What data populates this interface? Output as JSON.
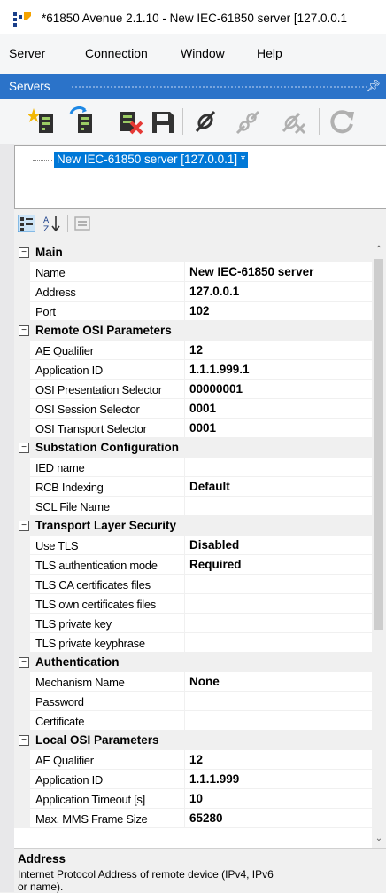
{
  "window": {
    "title": "*61850 Avenue 2.1.10 - New IEC-61850 server [127.0.0.1"
  },
  "menu": [
    "Server",
    "Connection",
    "Window",
    "Help"
  ],
  "dock": {
    "title": "Servers",
    "pin_icon": "pin-icon"
  },
  "toolbar": {
    "icons": [
      "new-server-icon",
      "connect-server-icon",
      "remove-server-icon",
      "save-icon",
      "connect-icon",
      "disconnect-icon",
      "abort-icon",
      "refresh-icon"
    ]
  },
  "tree": {
    "selected_node": "New IEC-61850 server [127.0.0.1] *"
  },
  "property_grid": {
    "toolbar_icons": [
      "categorized-icon",
      "alphabetical-icon",
      "property-pages-icon"
    ],
    "categories": [
      {
        "label": "Main",
        "rows": [
          {
            "name": "Name",
            "value": "New IEC-61850 server"
          },
          {
            "name": "Address",
            "value": "127.0.0.1"
          },
          {
            "name": "Port",
            "value": "102"
          }
        ]
      },
      {
        "label": "Remote OSI Parameters",
        "rows": [
          {
            "name": "AE Qualifier",
            "value": "12"
          },
          {
            "name": "Application ID",
            "value": "1.1.1.999.1"
          },
          {
            "name": "OSI Presentation Selector",
            "value": "00000001"
          },
          {
            "name": "OSI Session Selector",
            "value": "0001"
          },
          {
            "name": "OSI Transport Selector",
            "value": "0001"
          }
        ]
      },
      {
        "label": "Substation Configuration",
        "rows": [
          {
            "name": "IED name",
            "value": ""
          },
          {
            "name": "RCB Indexing",
            "value": "Default"
          },
          {
            "name": "SCL File Name",
            "value": ""
          }
        ]
      },
      {
        "label": "Transport Layer Security",
        "rows": [
          {
            "name": "Use TLS",
            "value": "Disabled"
          },
          {
            "name": "TLS authentication mode",
            "value": "Required"
          },
          {
            "name": "TLS CA certificates files",
            "value": ""
          },
          {
            "name": "TLS own certificates files",
            "value": ""
          },
          {
            "name": "TLS private key",
            "value": ""
          },
          {
            "name": "TLS private keyphrase",
            "value": ""
          }
        ]
      },
      {
        "label": "Authentication",
        "rows": [
          {
            "name": "Mechanism Name",
            "value": "None"
          },
          {
            "name": "Password",
            "value": ""
          },
          {
            "name": "Certificate",
            "value": ""
          }
        ]
      },
      {
        "label": "Local OSI Parameters",
        "rows": [
          {
            "name": "AE Qualifier",
            "value": "12"
          },
          {
            "name": "Application ID",
            "value": "1.1.1.999"
          },
          {
            "name": "Application Timeout [s]",
            "value": "10"
          },
          {
            "name": "Max. MMS Frame Size",
            "value": "65280"
          }
        ]
      }
    ]
  },
  "description": {
    "title": "Address",
    "text": "Internet Protocol Address of remote device (IPv4, IPv6 or name)."
  }
}
